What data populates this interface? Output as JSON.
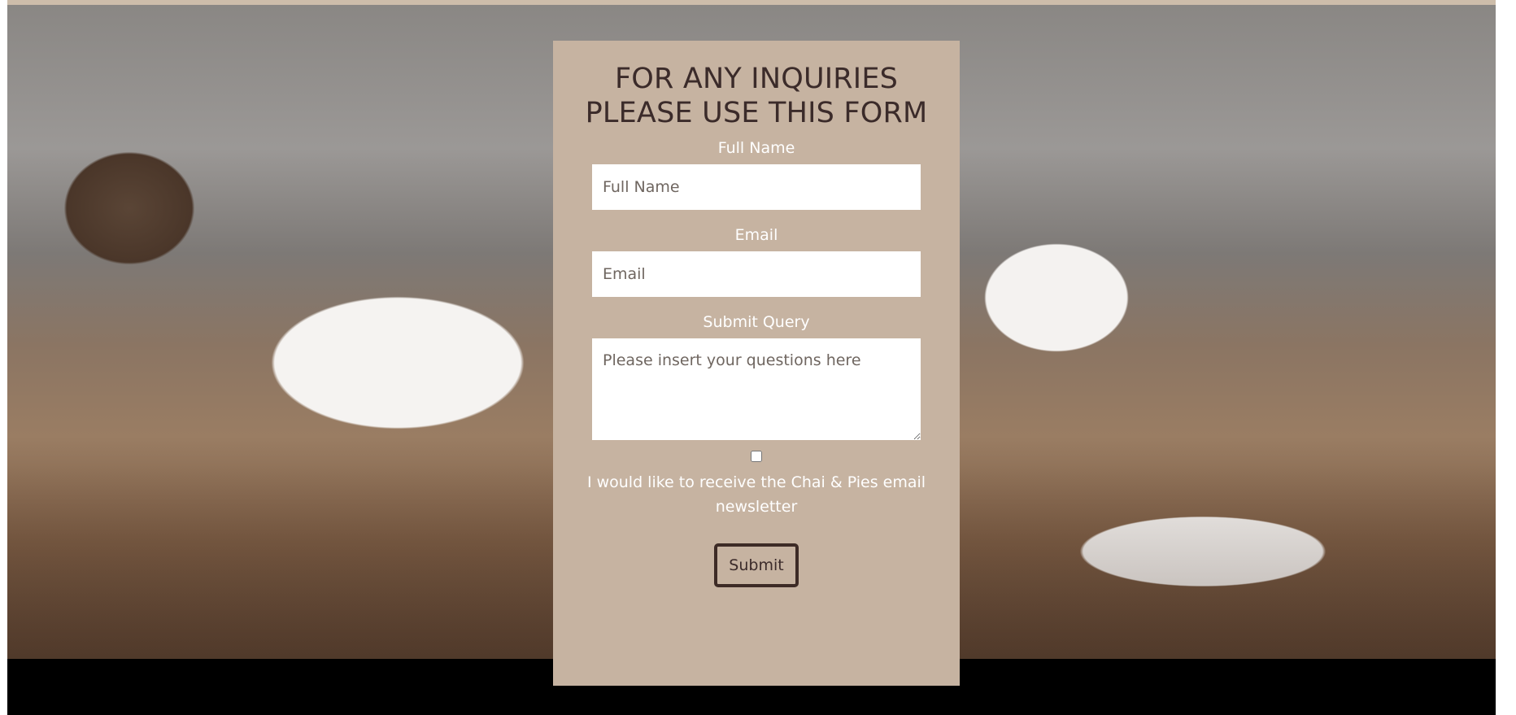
{
  "form": {
    "title_line1": "FOR ANY INQUIRIES",
    "title_line2": "PLEASE USE THIS FORM",
    "full_name_label": "Full Name",
    "full_name_placeholder": "Full Name",
    "email_label": "Email",
    "email_placeholder": "Email",
    "query_label": "Submit Query",
    "query_placeholder": "Please insert your questions here",
    "newsletter_checked": false,
    "newsletter_label": "I would like to receive the Chai & Pies email newsletter",
    "submit_label": "Submit"
  },
  "colors": {
    "panel_bg": "#c6b3a1",
    "title_text": "#3b2b2a",
    "label_text": "#ffffff",
    "button_border": "#3d2b26"
  }
}
